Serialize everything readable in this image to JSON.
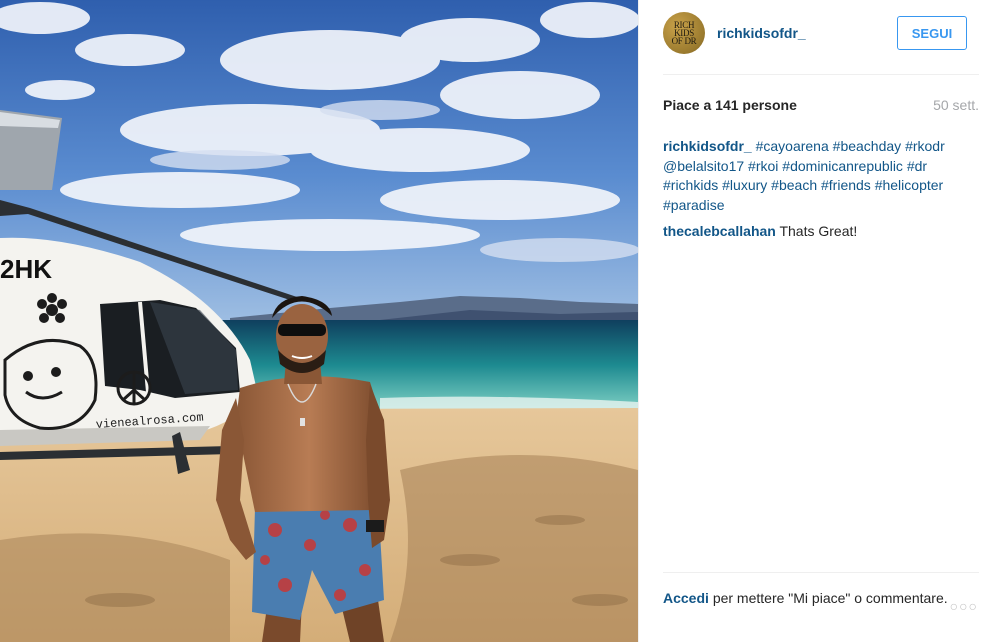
{
  "post": {
    "aircraft_registration": "2HK",
    "aircraft_livery_text": "vienealrosa.com"
  },
  "profile": {
    "avatar_text": "RICH KIDS OF DR",
    "username": "richkidsofdr_",
    "follow_label": "SEGUI"
  },
  "stats": {
    "likes": "Piace a 141 persone",
    "age": "50 sett."
  },
  "comments": [
    {
      "user": "richkidsofdr_",
      "tags": [
        "#cayoarena",
        "#beachday",
        "#rkodr",
        "@belalsito17",
        "#rkoi",
        "#dominicanrepublic",
        "#dr",
        "#richkids",
        "#luxury",
        "#beach",
        "#friends",
        "#helicopter",
        "#paradise"
      ]
    },
    {
      "user": "thecalebcallahan",
      "text": "Thats Great!"
    }
  ],
  "footer": {
    "login_link": "Accedi",
    "prompt_text": "per mettere \"Mi piace\" o commentare.",
    "more_icon": "ellipsis-icon"
  },
  "colors": {
    "link": "#125688",
    "follow_blue": "#3897f0",
    "muted": "#a5a7aa"
  }
}
